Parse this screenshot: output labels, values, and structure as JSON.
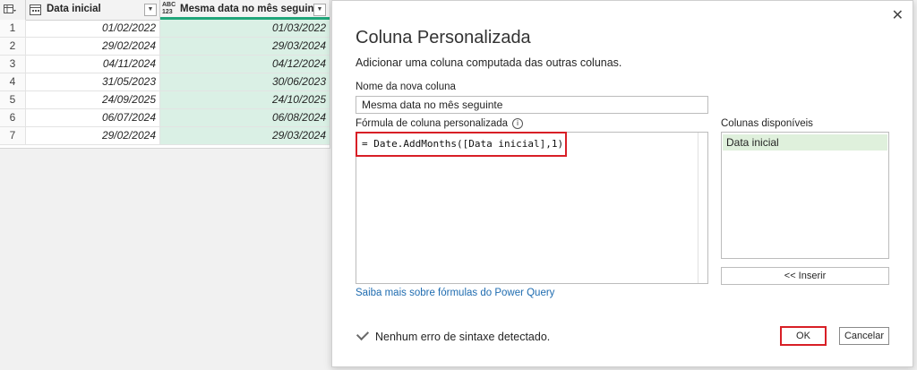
{
  "grid": {
    "columns": [
      {
        "name": "Data inicial",
        "type_icon": "calendar-icon"
      },
      {
        "name": "Mesma data no mês seguinte",
        "type_icon": "abc-123-icon",
        "type_text": "ABC\n123"
      }
    ],
    "rows": [
      {
        "index": "1",
        "c1": "01/02/2022",
        "c2": "01/03/2022"
      },
      {
        "index": "2",
        "c1": "29/02/2024",
        "c2": "29/03/2024"
      },
      {
        "index": "3",
        "c1": "04/11/2024",
        "c2": "04/12/2024"
      },
      {
        "index": "4",
        "c1": "31/05/2023",
        "c2": "30/06/2023"
      },
      {
        "index": "5",
        "c1": "24/09/2025",
        "c2": "24/10/2025"
      },
      {
        "index": "6",
        "c1": "06/07/2024",
        "c2": "06/08/2024"
      },
      {
        "index": "7",
        "c1": "29/02/2024",
        "c2": "29/03/2024"
      }
    ],
    "colors": {
      "selected_header": "#21a67a",
      "selected_column": "#daf0e5"
    }
  },
  "dialog": {
    "title": "Coluna Personalizada",
    "subtitle": "Adicionar uma coluna computada das outras colunas.",
    "name_label": "Nome da nova coluna",
    "name_value": "Mesma data no mês seguinte",
    "formula_label": "Fórmula de coluna personalizada",
    "formula_info_icon": "info-icon",
    "formula": "= Date.AddMonths([Data inicial],1)",
    "available_label": "Colunas disponíveis",
    "available_columns": [
      "Data inicial"
    ],
    "insert_label": "<< Inserir",
    "help_link": "Saiba mais sobre fórmulas do Power Query",
    "status": "Nenhum erro de sintaxe detectado.",
    "ok_label": "OK",
    "cancel_label": "Cancelar",
    "close_icon": "close-icon",
    "highlight_color": "#d81f26"
  }
}
